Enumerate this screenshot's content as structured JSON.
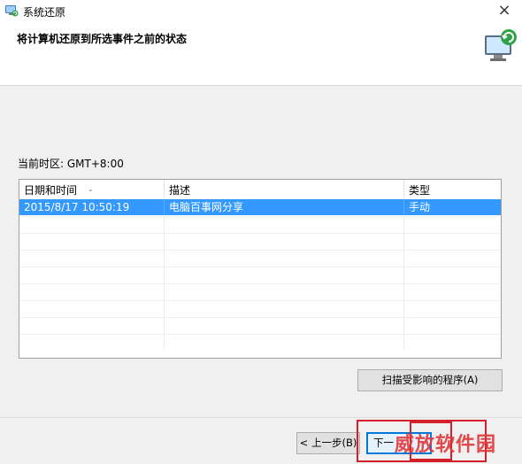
{
  "window": {
    "title": "系统还原",
    "close_glyph": "×"
  },
  "header": {
    "title": "将计算机还原到所选事件之前的状态"
  },
  "timezone_label": "当前时区: GMT+8:00",
  "table": {
    "columns": [
      "日期和时间",
      "描述",
      "类型"
    ],
    "rows": [
      {
        "date": "2015/8/17 10:50:19",
        "description": "电脑百事网分享",
        "type": "手动",
        "selected": true
      }
    ]
  },
  "buttons": {
    "scan": "扫描受影响的程序(A)",
    "back": "< 上一步(B)",
    "next": "下一"
  },
  "watermark": "威放软件园",
  "icons": {
    "app": "system-restore-icon",
    "header": "computer-restore-icon",
    "sort": "sort-down-icon"
  },
  "colors": {
    "selection": "#3399ff",
    "highlight": "#d4202a",
    "primary_border": "#0078d7"
  }
}
